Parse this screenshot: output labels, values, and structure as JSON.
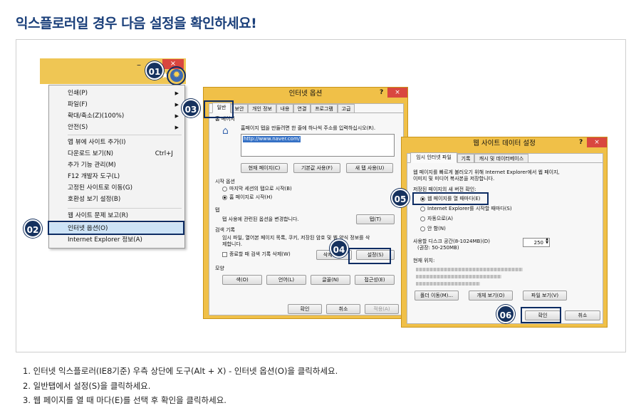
{
  "header": {
    "title": "익스플로러일 경우 다음 설정을 확인하세요!"
  },
  "ie": {
    "minimize": "–",
    "close": "×",
    "home_icon": "home-icon",
    "star_icon": "star-icon",
    "gear_icon": "gear-icon"
  },
  "menu": {
    "items": [
      {
        "label": "인쇄(P)",
        "arrow": "▶"
      },
      {
        "label": "파일(F)",
        "arrow": "▶"
      },
      {
        "label": "확대/축소(Z)(100%)",
        "arrow": "▶"
      },
      {
        "label": "안전(S)",
        "arrow": "▶"
      },
      {
        "label": "앱 뷰에 사이트 추가(I)"
      },
      {
        "label": "다운로드 보기(N)",
        "shortcut": "Ctrl+J"
      },
      {
        "label": "추가 기능 관리(M)"
      },
      {
        "label": "F12 개발자 도구(L)"
      },
      {
        "label": "고정된 사이트로 이동(G)"
      },
      {
        "label": "호환성 보기 설정(B)"
      },
      {
        "label": "웹 사이트 문제 보고(R)"
      },
      {
        "label": "인터넷 옵션(O)"
      },
      {
        "label": "Internet Explorer 정보(A)"
      }
    ]
  },
  "badges": [
    "01",
    "02",
    "03",
    "04",
    "05",
    "06"
  ],
  "inet": {
    "title": "인터넷 옵션",
    "help": "?",
    "close": "×",
    "tabs": [
      "일반",
      "보안",
      "개인 정보",
      "내용",
      "연결",
      "프로그램",
      "고급"
    ],
    "home_group": "홈 페이지",
    "home_desc": "홈페이지 탭을 만들려면 한 줄에 하나씩 주소를 입력하십시오(R).",
    "home_url": "http://www.naver.com/",
    "btn_current": "현재 페이지(C)",
    "btn_default": "기본값 사용(F)",
    "btn_newtab": "새 탭 사용(U)",
    "startup_group": "시작 옵션",
    "startup_opt1": "마지막 세션의 탭으로 시작(B)",
    "startup_opt2": "홈 페이지로 시작(H)",
    "tab_group": "탭",
    "tab_desc": "탭 사용에 관련된 옵션을 변경합니다.",
    "tab_btn": "탭(T)",
    "history_group": "검색 기록",
    "history_desc1": "임시 파일, 열어본 페이지 목록, 쿠키, 저장된 암호 및 웹 양식 정보를 삭",
    "history_desc2": "제합니다.",
    "history_chk": "종료할 때 검색 기록 삭제(W)",
    "btn_delete": "삭제(D)...",
    "btn_settings": "설정(S)",
    "look_group": "모양",
    "btn_colors": "색(O)",
    "btn_lang": "언어(L)",
    "btn_fonts": "글꼴(N)",
    "btn_access": "접근성(E)",
    "btn_ok": "확인",
    "btn_cancel": "취소",
    "btn_apply": "적용(A)"
  },
  "web": {
    "title": "웹 사이트 데이터 설정",
    "help": "?",
    "close": "×",
    "tabs": [
      "임시 인터넷 파일",
      "기록",
      "캐시 및 데이터베이스"
    ],
    "desc1": "웹 페이지를 빠르게 불러오기 위해 Internet Explorer에서 웹 페이지,",
    "desc2": "이미지 및 미디어 복사본을 저장합니다.",
    "check_label": "저장된 페이지의 새 버전 확인:",
    "opt1": "웹 페이지를 열 때마다(E)",
    "opt2": "Internet Explorer를 시작할 때마다(S)",
    "opt3": "자동으로(A)",
    "opt4": "안 함(N)",
    "disk_label": "사용할 디스크 공간(8-1024MB)(D)",
    "disk_hint": "(권장: 50-250MB)",
    "disk_value": "250",
    "location_label": "현재 위치:",
    "btn_move": "폴더 이동(M)...",
    "btn_objects": "개체 보기(O)",
    "btn_files": "파일 보기(V)",
    "btn_ok": "확인",
    "btn_cancel": "취소"
  },
  "steps": [
    "1. 인터넷 익스플로러(IE8기준) 우측 상단에 도구(Alt + X) - 인터넷 옵션(O)을 클릭하세요.",
    "2. 일반탭에서 설정(S)을 클릭하세요.",
    "3. 웹 페이지를 열 때 마다(E)를 선택 후 확인을 클릭하세요."
  ]
}
